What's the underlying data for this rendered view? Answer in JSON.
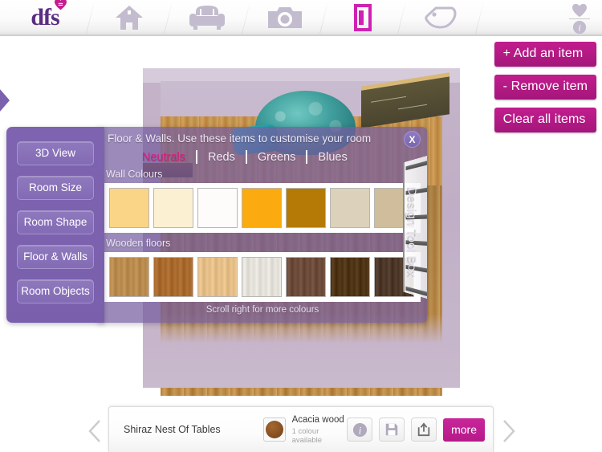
{
  "topnav": {
    "logo_text": "dfs",
    "logo_icon": "heart-icon",
    "items": [
      {
        "name": "home-icon",
        "label": "Home"
      },
      {
        "name": "sofa-icon",
        "label": "Furniture"
      },
      {
        "name": "camera-icon",
        "label": "Camera"
      },
      {
        "name": "room-planner-icon",
        "label": "Room Planner"
      },
      {
        "name": "tag-icon",
        "label": "Offers"
      },
      {
        "name": "info-icon",
        "label": "Info"
      }
    ]
  },
  "actions": {
    "add_item": "+ Add an item",
    "remove_item": "- Remove item",
    "clear_all": "Clear all items"
  },
  "left_menu": {
    "items": [
      {
        "label": "3D View"
      },
      {
        "label": "Room Size"
      },
      {
        "label": "Room Shape"
      },
      {
        "label": "Floor & Walls"
      },
      {
        "label": "Room Objects"
      }
    ]
  },
  "toolbox": {
    "title": "Floor & Walls. Use these items to customise your room",
    "close_label": "X",
    "vertical_label": "Design Tool Box",
    "tabs": [
      {
        "label": "Neutrals",
        "active": true
      },
      {
        "label": "Reds",
        "active": false
      },
      {
        "label": "Greens",
        "active": false
      },
      {
        "label": "Blues",
        "active": false
      }
    ],
    "wall_section_label": "Wall Colours",
    "floor_section_label": "Wooden floors",
    "scroll_hint": "Scroll right for more colours",
    "wall_colours": [
      {
        "name": "light-gold",
        "hex": "#fad587"
      },
      {
        "name": "cream",
        "hex": "#fcf0d2"
      },
      {
        "name": "white",
        "hex": "#fdfcfa"
      },
      {
        "name": "amber",
        "hex": "#fbab10"
      },
      {
        "name": "dark-gold",
        "hex": "#b57a06"
      },
      {
        "name": "sand",
        "hex": "#dcd2bb"
      },
      {
        "name": "taupe",
        "hex": "#cfbd9b"
      }
    ],
    "wooden_floors": [
      {
        "name": "golden-oak",
        "hex": "#b98a4d"
      },
      {
        "name": "medium-oak",
        "hex": "#a8692c"
      },
      {
        "name": "natural-pine",
        "hex": "#e4bd87"
      },
      {
        "name": "whitewashed",
        "hex": "#e3e0d9"
      },
      {
        "name": "walnut",
        "hex": "#6c4a3a"
      },
      {
        "name": "dark-antique",
        "hex": "#4e3314"
      },
      {
        "name": "ebony",
        "hex": "#4b3628"
      }
    ]
  },
  "product_bar": {
    "product_name": "Shiraz Nest Of Tables",
    "colour_name": "Acacia wood",
    "colour_availability": "1 colour available",
    "colour_hex": "#8a5222",
    "more_label": "more",
    "actions": [
      {
        "name": "info-icon",
        "label": "Info"
      },
      {
        "name": "save-icon",
        "label": "Save"
      },
      {
        "name": "share-icon",
        "label": "Share"
      }
    ],
    "prev_label": "Previous",
    "next_label": "Next"
  },
  "colors": {
    "brand_magenta": "#b6198a",
    "brand_purple": "#5b2d82",
    "panel_purple": "#745da0",
    "accent_pink": "#e0197f"
  }
}
